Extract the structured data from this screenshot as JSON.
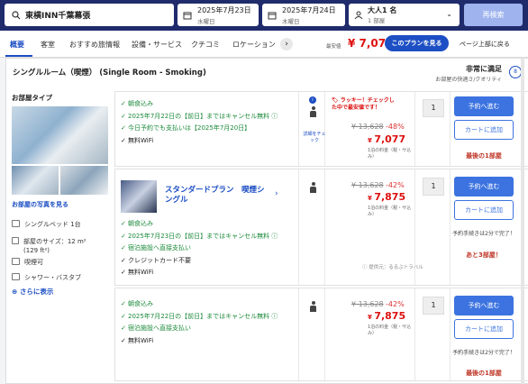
{
  "search": {
    "hotel": "東横INN千葉幕張",
    "checkin_date": "2025年7月23日",
    "checkin_day": "水曜日",
    "checkout_date": "2025年7月24日",
    "checkout_day": "木曜日",
    "guests": "大人1 名",
    "rooms": "1 部屋",
    "button": "再検索"
  },
  "nav": {
    "tabs": [
      "概要",
      "客室",
      "おすすめ旅情報",
      "設備・サービス",
      "クチコミ",
      "ロケーション"
    ],
    "min_label": "最安値",
    "min_price": "¥ 7,077",
    "see_plan": "このプランを見る",
    "to_top": "ページ上部に戻る"
  },
  "room": {
    "title": "シングルルーム（喫煙） (Single Room - Smoking)",
    "rating": "非常に満足",
    "rating_sub": "お部屋の快適さ/クオリティ",
    "rating_icon": "8",
    "photos_title": "お部屋タイプ",
    "see_photos": "お部屋の写真を見る",
    "amenities": [
      "シングルベッド 1台",
      "部屋のサイズ：12 m² (129 ft²)",
      "喫煙可",
      "シャワー・バスタブ"
    ],
    "more": "さらに表示"
  },
  "plans": [
    {
      "items": [
        {
          "t": "朝食込み",
          "c": "g"
        },
        {
          "t": "2025年7月22日の【前日】まではキャンセル無料",
          "c": "g"
        },
        {
          "t": "今日予約でも支払いは【2025年7月20日】",
          "c": "g"
        },
        {
          "t": "無料WiFi",
          "c": "b"
        }
      ],
      "lucky": "ラッキー！チェックした中で最安値です！",
      "details": "詳細をチェック",
      "orig": "¥ 13,628",
      "pct": "-48%",
      "price": "7,077",
      "per_night": "1泊の料金（税・サ込み）",
      "qty": "1",
      "book": "予約へ進む",
      "cart": "カートに追加",
      "status": "最後の1部屋"
    },
    {
      "name": "スタンダードプラン　喫煙シングル",
      "items": [
        {
          "t": "朝食込み",
          "c": "g"
        },
        {
          "t": "2025年7月23日の【前日】まではキャンセル無料",
          "c": "g"
        },
        {
          "t": "宿泊施設へ直接支払い",
          "c": "g"
        },
        {
          "t": "クレジットカード不要",
          "c": "b"
        },
        {
          "t": "無料WiFi",
          "c": "b"
        }
      ],
      "provider": "提供元：るるぶトラベル",
      "orig": "¥ 13,628",
      "pct": "-42%",
      "price": "7,875",
      "per_night": "1泊の料金（税・サ込み）",
      "qty": "1",
      "book": "予約へ進む",
      "cart": "カートに追加",
      "note": "予約手続きは2分で完了！",
      "status": "あと3部屋！"
    },
    {
      "items": [
        {
          "t": "朝食込み",
          "c": "g"
        },
        {
          "t": "2025年7月22日の【前日】まではキャンセル無料",
          "c": "g"
        },
        {
          "t": "宿泊施設へ直接支払い",
          "c": "g"
        },
        {
          "t": "無料WiFi",
          "c": "b"
        }
      ],
      "orig": "¥ 13,628",
      "pct": "-42%",
      "price": "7,875",
      "per_night": "1泊の料金（税・サ込み）",
      "qty": "1",
      "book": "予約へ進む",
      "cart": "カートに追加",
      "note": "予約手続きは2分で完了！",
      "status": "最後の1部屋"
    }
  ],
  "colors": {
    "header": "#1f2b6b",
    "accent": "#1d4fc4",
    "green": "#1b8a3a",
    "red": "#d11"
  }
}
